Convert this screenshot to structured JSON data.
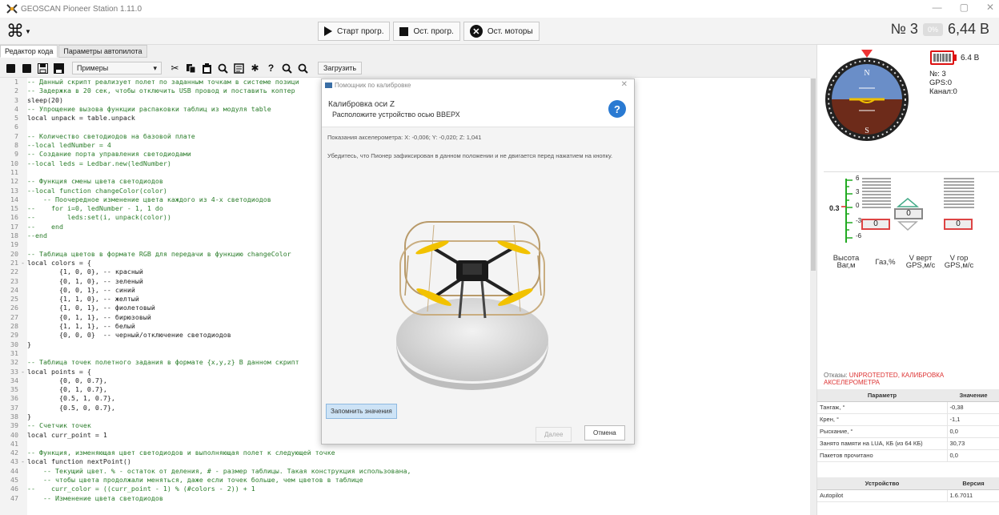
{
  "window": {
    "title": "GEOSCAN Pioneer Station 1.11.0",
    "controls": {
      "minimize": "—",
      "maximize": "▢",
      "close": "✕"
    }
  },
  "toolbar": {
    "menu_icon": "⌘",
    "start": "Старт прогр.",
    "stop_prog": "Ост. прогр.",
    "stop_motors": "Ост. моторы",
    "drone_number": "№ 3",
    "battery_pill": "0%",
    "battery_voltage": "6,44 В"
  },
  "tabs": [
    {
      "label": "Редактор кода",
      "active": true
    },
    {
      "label": "Параметры автопилота",
      "active": false
    }
  ],
  "editor_toolbar": {
    "examples_label": "Примеры",
    "load_label": "Загрузить"
  },
  "code_lines": [
    {
      "n": "1",
      "fold": "",
      "text": "-- Данный скрипт реализует полет по заданным точкам в системе позици",
      "type": "cmt"
    },
    {
      "n": "2",
      "fold": "",
      "text": "-- Задержка в 20 сек, чтобы отключить USB провод и поставить коптер",
      "type": "cmt"
    },
    {
      "n": "3",
      "fold": "",
      "text": "sleep(20)",
      "type": "code"
    },
    {
      "n": "4",
      "fold": "",
      "text": "-- Упрощение вызова функции распаковки таблиц из модуля table",
      "type": "cmt"
    },
    {
      "n": "5",
      "fold": "",
      "text": "local unpack = table.unpack",
      "type": "code"
    },
    {
      "n": "6",
      "fold": "",
      "text": "",
      "type": "code"
    },
    {
      "n": "7",
      "fold": "",
      "text": "-- Количество светодиодов на базовой плате",
      "type": "cmt"
    },
    {
      "n": "8",
      "fold": "",
      "text": "--local ledNumber = 4",
      "type": "cmt"
    },
    {
      "n": "9",
      "fold": "",
      "text": "-- Создание порта управления светодиодами",
      "type": "cmt"
    },
    {
      "n": "10",
      "fold": "",
      "text": "--local leds = Ledbar.new(ledNumber)",
      "type": "cmt"
    },
    {
      "n": "11",
      "fold": "",
      "text": "",
      "type": "code"
    },
    {
      "n": "12",
      "fold": "",
      "text": "-- Функция смены цвета светодиодов",
      "type": "cmt"
    },
    {
      "n": "13",
      "fold": "",
      "text": "--local function changeColor(color)",
      "type": "cmt"
    },
    {
      "n": "14",
      "fold": "",
      "text": "    -- Поочередное изменение цвета каждого из 4-х светодиодов",
      "type": "cmt"
    },
    {
      "n": "15",
      "fold": "",
      "text": "--    for i=0, ledNumber - 1, 1 do",
      "type": "cmt"
    },
    {
      "n": "16",
      "fold": "",
      "text": "--        leds:set(i, unpack(color))",
      "type": "cmt"
    },
    {
      "n": "17",
      "fold": "",
      "text": "--    end",
      "type": "cmt"
    },
    {
      "n": "18",
      "fold": "",
      "text": "--end",
      "type": "cmt"
    },
    {
      "n": "19",
      "fold": "",
      "text": "",
      "type": "code"
    },
    {
      "n": "20",
      "fold": "",
      "text": "-- Таблица цветов в формате RGB для передачи в функцию changeColor",
      "type": "cmt"
    },
    {
      "n": "21",
      "fold": "-",
      "text": "local colors = {",
      "type": "code"
    },
    {
      "n": "22",
      "fold": "",
      "text": "        {1, 0, 0}, -- красный",
      "type": "code"
    },
    {
      "n": "23",
      "fold": "",
      "text": "        {0, 1, 0}, -- зеленый",
      "type": "code"
    },
    {
      "n": "24",
      "fold": "",
      "text": "        {0, 0, 1}, -- синий",
      "type": "code"
    },
    {
      "n": "25",
      "fold": "",
      "text": "        {1, 1, 0}, -- желтый",
      "type": "code"
    },
    {
      "n": "26",
      "fold": "",
      "text": "        {1, 0, 1}, -- фиолетовый",
      "type": "code"
    },
    {
      "n": "27",
      "fold": "",
      "text": "        {0, 1, 1}, -- бирюзовый",
      "type": "code"
    },
    {
      "n": "28",
      "fold": "",
      "text": "        {1, 1, 1}, -- белый",
      "type": "code"
    },
    {
      "n": "29",
      "fold": "",
      "text": "        {0, 0, 0}  -- черный/отключение светодиодов",
      "type": "code"
    },
    {
      "n": "30",
      "fold": "",
      "text": "}",
      "type": "code"
    },
    {
      "n": "31",
      "fold": "",
      "text": "",
      "type": "code"
    },
    {
      "n": "32",
      "fold": "",
      "text": "-- Таблица точек полетного задания в формате {x,y,z} В данном скрипт",
      "type": "cmt"
    },
    {
      "n": "33",
      "fold": "-",
      "text": "local points = {",
      "type": "code"
    },
    {
      "n": "34",
      "fold": "",
      "text": "        {0, 0, 0.7},",
      "type": "code"
    },
    {
      "n": "35",
      "fold": "",
      "text": "        {0, 1, 0.7},",
      "type": "code"
    },
    {
      "n": "36",
      "fold": "",
      "text": "        {0.5, 1, 0.7},",
      "type": "code"
    },
    {
      "n": "37",
      "fold": "",
      "text": "        {0.5, 0, 0.7},",
      "type": "code"
    },
    {
      "n": "38",
      "fold": "",
      "text": "}",
      "type": "code"
    },
    {
      "n": "39",
      "fold": "",
      "text": "-- Счетчик точек",
      "type": "cmt"
    },
    {
      "n": "40",
      "fold": "",
      "text": "local curr_point = 1",
      "type": "code"
    },
    {
      "n": "41",
      "fold": "",
      "text": "",
      "type": "code"
    },
    {
      "n": "42",
      "fold": "",
      "text": "-- Функция, изменяющая цвет светодиодов и выполняющая полет к следующей точке",
      "type": "cmt"
    },
    {
      "n": "43",
      "fold": "-",
      "text": "local function nextPoint()",
      "type": "code"
    },
    {
      "n": "44",
      "fold": "",
      "text": "    -- Текущий цвет. % - остаток от деления, # - размер таблицы. Такая конструкция использована,",
      "type": "cmt"
    },
    {
      "n": "45",
      "fold": "",
      "text": "    -- чтобы цвета продолжали меняться, даже если точек больше, чем цветов в таблице",
      "type": "cmt"
    },
    {
      "n": "46",
      "fold": "",
      "text": "--    curr_color = ((curr_point - 1) % (#colors - 2)) + 1",
      "type": "cmt"
    },
    {
      "n": "47",
      "fold": "",
      "text": "    -- Изменение цвета светодиодов",
      "type": "cmt"
    }
  ],
  "dialog": {
    "window_title": "Помощник по калибровке",
    "heading": "Калибровка оси Z",
    "instruction": "Расположите устройство осью ВВЕРХ",
    "accel_readout": "Показания акселерометра:  X: -0,006; Y: -0,020; Z: 1,041",
    "note": "Убедитесь, что Пионер зафиксирован в данном положении и не двигается перед нажатием на кнопку.",
    "remember_btn": "Запомнить значения",
    "next_btn": "Далее",
    "cancel_btn": "Отмена"
  },
  "telemetry": {
    "battery_voltage": "6.4 В",
    "number": "№: 3",
    "gps": "GPS:0",
    "channel": "Канал:0",
    "compass_n": "N",
    "compass_s": "S",
    "altitude_value": "0.3",
    "scale_ticks": [
      "6",
      "3",
      "0",
      "-3",
      "-6"
    ],
    "vbox_left": "0",
    "vbox_center": "0",
    "vbox_right": "0",
    "label_altitude": "Высота Baг,м",
    "label_gas": "Газ,%",
    "label_vvert": "V верт GPS,м/с",
    "label_vhor": "V гор GPS,м/с"
  },
  "faults": {
    "label": "Отказы:",
    "value": "UNPROTEDTED, КАЛИБРОВКА АКСЕЛЕРОМЕТРА"
  },
  "params_table": {
    "headers": [
      "Параметр",
      "Значение"
    ],
    "rows": [
      [
        "Тангаж, °",
        "-0,38"
      ],
      [
        "Крен, °",
        "-1,1"
      ],
      [
        "Рыскание, °",
        "0,0"
      ],
      [
        "Занято памяти на LUA, КБ (из 64 КБ)",
        "30,73"
      ],
      [
        "Пакетов прочитано",
        "0,0"
      ]
    ]
  },
  "device_table": {
    "headers": [
      "Устройство",
      "Версия"
    ],
    "rows": [
      [
        "Autopilot",
        "1.6.7011"
      ]
    ]
  },
  "colors": {
    "comment_green": "#2b7d2b",
    "fault_red": "#d33",
    "help_blue": "#2a7ad2",
    "sky_blue": "#6a8ec8",
    "ground_brown": "#6d2b1a"
  }
}
